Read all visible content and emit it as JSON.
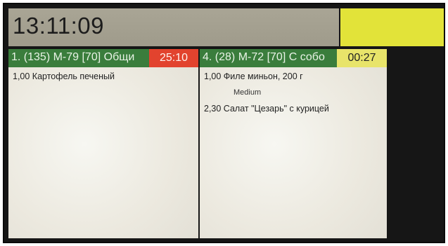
{
  "clock": "13:11:09",
  "tickets": [
    {
      "title": "1. (135) М-79 [70] Общи",
      "timer": "25:10",
      "timer_color": "#e2432e",
      "items": [
        {
          "text": "1,00 Картофель печеный"
        }
      ]
    },
    {
      "title": "4. (28) М-72 [70] С собо",
      "timer": "00:27",
      "timer_color": "#e8e46a",
      "items": [
        {
          "text": "1,00 Филе миньон, 200 г"
        },
        {
          "text": "Medium",
          "modifier": true
        },
        {
          "text": "2,30 Салат \"Цезарь\" с курицей"
        }
      ]
    }
  ]
}
